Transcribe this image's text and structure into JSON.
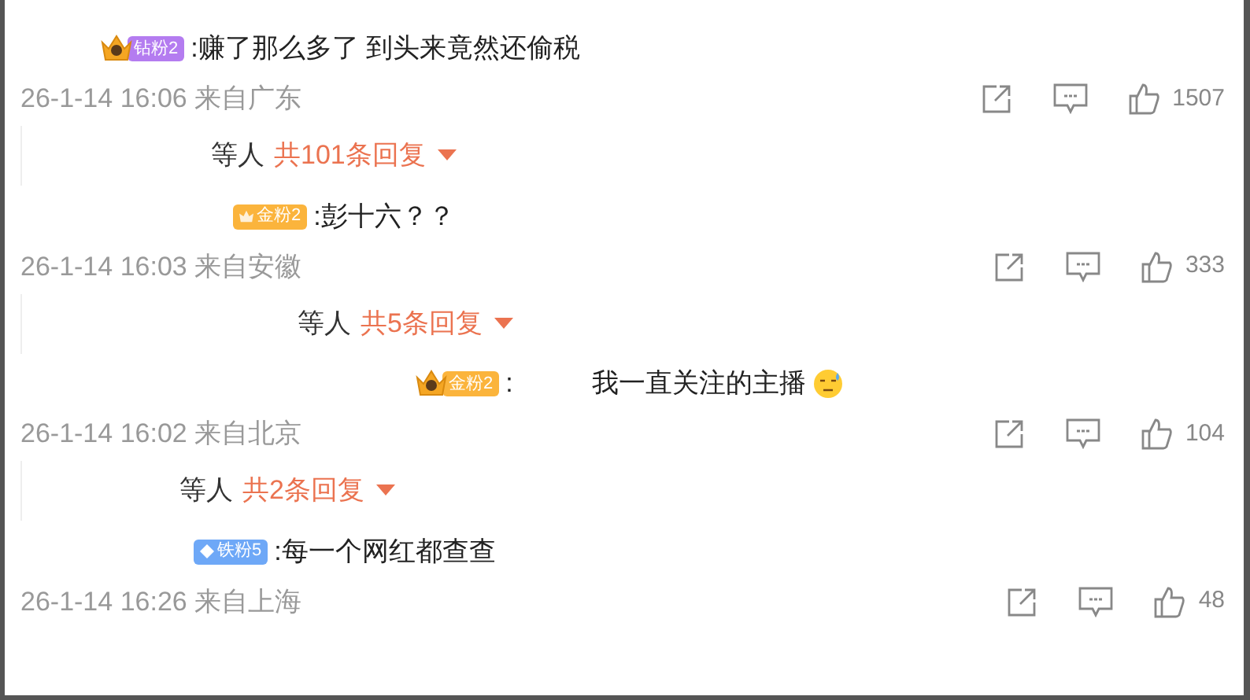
{
  "comments": [
    {
      "badge": {
        "kind": "crown",
        "label": "钻粉2",
        "color": "#b47cf0"
      },
      "text": ":赚了那么多了 到头来竟然还偷税",
      "time": "26-1-14 16:06 来自广东",
      "likes": "1507",
      "replies": {
        "prefix": "等人",
        "count": "共101条回复",
        "expanded": false
      }
    },
    {
      "badge": {
        "kind": "plain",
        "label": "金粉2",
        "color": "#fbb43c"
      },
      "text": ":彭十六？？",
      "time": "26-1-14 16:03 来自安徽",
      "likes": "333",
      "replies": {
        "prefix": "等人",
        "count": "共5条回复",
        "expanded": false
      }
    },
    {
      "badge": {
        "kind": "crown",
        "label": "金粉2",
        "color": "#fbb43c"
      },
      "text": ":",
      "text_2": "我一直关注的主播",
      "sweat_emoji": true,
      "time": "26-1-14 16:02 来自北京",
      "likes": "104",
      "replies": {
        "prefix": "等人",
        "count": "共2条回复",
        "expanded": false
      }
    },
    {
      "badge": {
        "kind": "diamond",
        "label": "铁粉5",
        "color": "#6ea8f7"
      },
      "text": ":每一个网红都查查",
      "time": "26-1-14 16:26 来自上海",
      "likes": "48"
    }
  ]
}
